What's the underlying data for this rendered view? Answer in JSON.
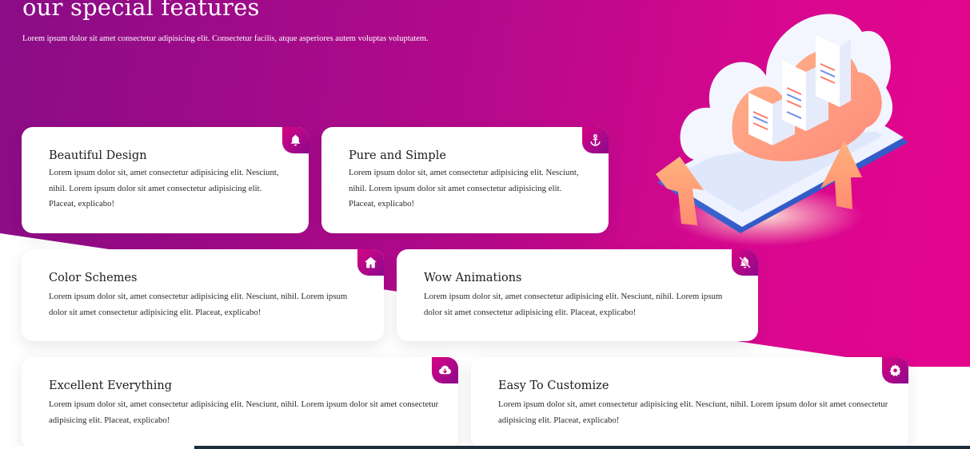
{
  "section": {
    "heading": "our special features",
    "subtitle": "Lorem ipsum dolor sit amet consectetur adipisicing elit. Consectetur facilis, atque asperiores autem voluptas voluptatem."
  },
  "colors": {
    "gradient_start": "#8a0c86",
    "gradient_end": "#e6058e",
    "card_background": "#ffffff"
  },
  "features": [
    {
      "title": "Beautiful Design",
      "icon": "bell-icon",
      "text": "Lorem ipsum dolor sit, amet consectetur adipisicing elit. Nesciunt, nihil. Lorem ipsum dolor sit amet consectetur adipisicing elit. Placeat, explicabo!"
    },
    {
      "title": "Pure and Simple",
      "icon": "anchor-icon",
      "text": "Lorem ipsum dolor sit, amet consectetur adipisicing elit. Nesciunt, nihil. Lorem ipsum dolor sit amet consectetur adipisicing elit. Placeat, explicabo!"
    },
    {
      "title": "Color Schemes",
      "icon": "home-icon",
      "text": "Lorem ipsum dolor sit, amet consectetur adipisicing elit. Nesciunt, nihil. Lorem ipsum dolor sit amet consectetur adipisicing elit. Placeat, explicabo!"
    },
    {
      "title": "Wow Animations",
      "icon": "bell-slash-icon",
      "text": "Lorem ipsum dolor sit, amet consectetur adipisicing elit. Nesciunt, nihil. Lorem ipsum dolor sit amet consectetur adipisicing elit. Placeat, explicabo!"
    },
    {
      "title": "Excellent Everything",
      "icon": "cloud-download-icon",
      "text": "Lorem ipsum dolor sit, amet consectetur adipisicing elit. Nesciunt, nihil. Lorem ipsum dolor sit amet consectetur adipisicing elit. Placeat, explicabo!"
    },
    {
      "title": "Easy To Customize",
      "icon": "gear-icon",
      "text": "Lorem ipsum dolor sit, amet consectetur adipisicing elit. Nesciunt, nihil. Lorem ipsum dolor sit amet consectetur adipisicing elit. Placeat, explicabo!"
    }
  ]
}
